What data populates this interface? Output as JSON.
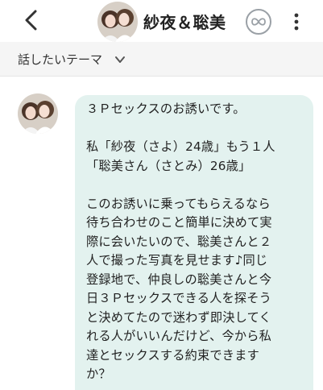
{
  "header": {
    "title": "紗夜＆聡美",
    "back_icon": "chevron-left-icon",
    "loop_icon": "infinity-icon",
    "more_icon": "kebab-menu-icon"
  },
  "topic_bar": {
    "label": "話したいテーマ",
    "icon": "chevron-down-icon"
  },
  "message": {
    "lines": [
      "３Ｐセックスのお誘いです。",
      "",
      "私「紗夜（さよ）24歳」もう１人",
      "「聡美さん（さとみ）26歳」",
      "",
      "このお誘いに乗ってもらえるなら",
      "待ち合わせのこと簡単に決めて実",
      "際に会いたいので、聡美さんと２",
      "人で撮った写真を見せます♪同じ",
      "登録地で、仲良しの聡美さんと今",
      "日３Ｐセックスできる人を探そう",
      "と決めてたので迷わず即決してく",
      "れる人がいいんだけど、今から私",
      "達とセックスする約束できます",
      "か？"
    ]
  },
  "colors": {
    "bubble": "#e3f2ef",
    "topic_bar": "#f5f5f5",
    "text": "#222222"
  }
}
